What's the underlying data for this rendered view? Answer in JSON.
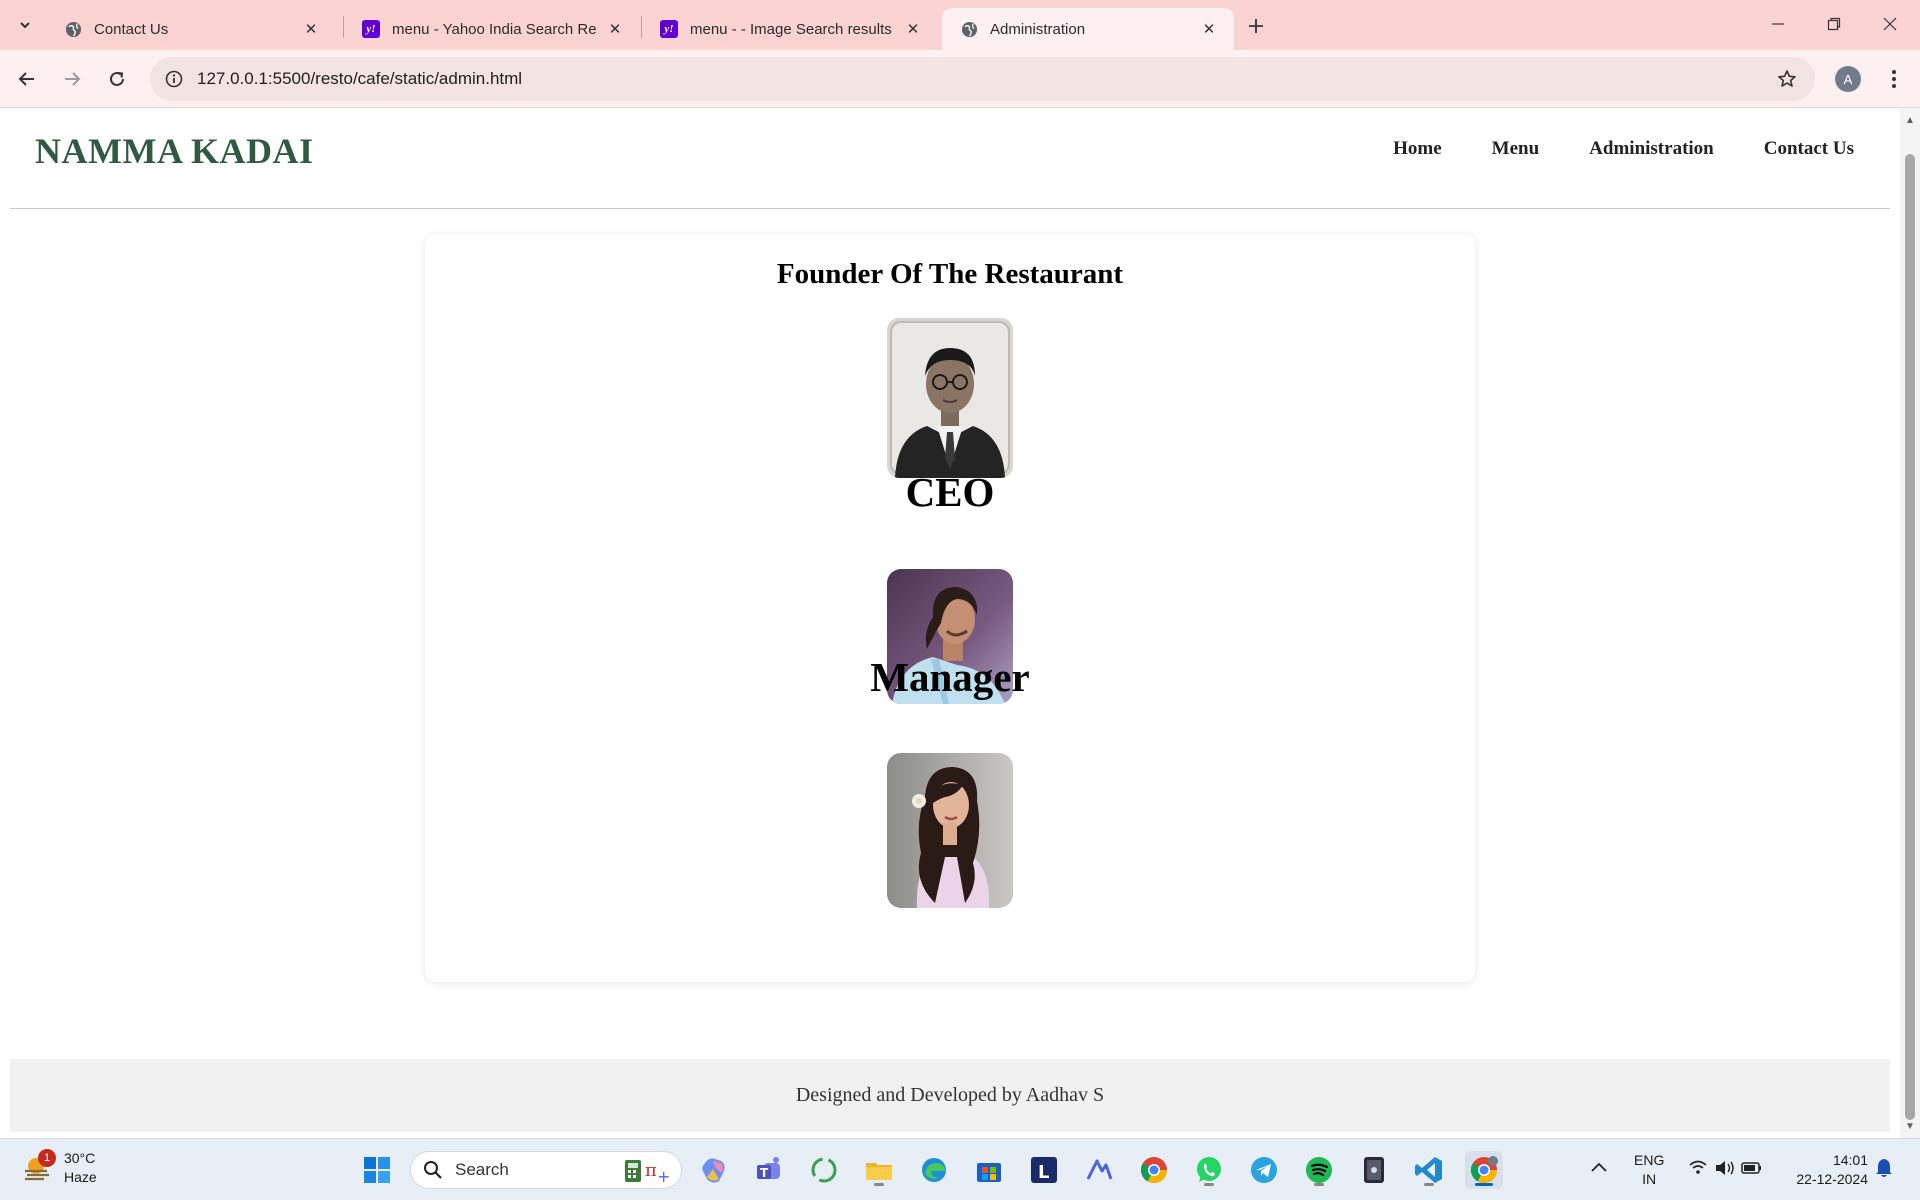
{
  "browser": {
    "tabs": [
      {
        "title": "Contact Us",
        "favicon": "globe-icon",
        "active": false
      },
      {
        "title": "menu - Yahoo India Search Results",
        "favicon": "yahoo-icon",
        "active": false
      },
      {
        "title": "menu - - Image Search results",
        "favicon": "yahoo-icon",
        "active": false
      },
      {
        "title": "Administration",
        "favicon": "globe-icon",
        "active": true
      }
    ],
    "url": "127.0.0.1:5500/resto/cafe/static/admin.html",
    "profile_initial": "A"
  },
  "site": {
    "logo": "NAMMA KADAI",
    "nav": [
      "Home",
      "Menu",
      "Administration",
      "Contact Us"
    ],
    "sections": [
      {
        "heading": "Founder Of The Restaurant",
        "photo": "founder-photo"
      },
      {
        "heading": "CEO",
        "photo": "ceo-photo"
      },
      {
        "heading": "Manager",
        "photo": "manager-photo"
      }
    ],
    "footer": "Designed and Developed by Aadhav S"
  },
  "taskbar": {
    "weather": {
      "temp": "30°C",
      "condition": "Haze",
      "badge": "1"
    },
    "search_placeholder": "Search",
    "lang": {
      "line1": "ENG",
      "line2": "IN"
    },
    "time": "14:01",
    "date": "22-12-2024",
    "apps": [
      "windows-start-icon",
      "calculator-icon",
      "copilot-icon",
      "teams-icon",
      "refresh-app-icon",
      "file-explorer-icon",
      "edge-icon",
      "store-icon",
      "l-app-icon",
      "atlas-icon",
      "chrome-icon",
      "whatsapp-icon",
      "telegram-icon",
      "spotify-icon",
      "phone-link-icon",
      "vscode-icon",
      "chrome-profile-icon"
    ]
  },
  "colors": {
    "tab_strip": "#fbd3d3",
    "toolbar": "#fdf0f0",
    "logo": "#2f5a3f",
    "footer_bg": "#f1f1f1"
  }
}
